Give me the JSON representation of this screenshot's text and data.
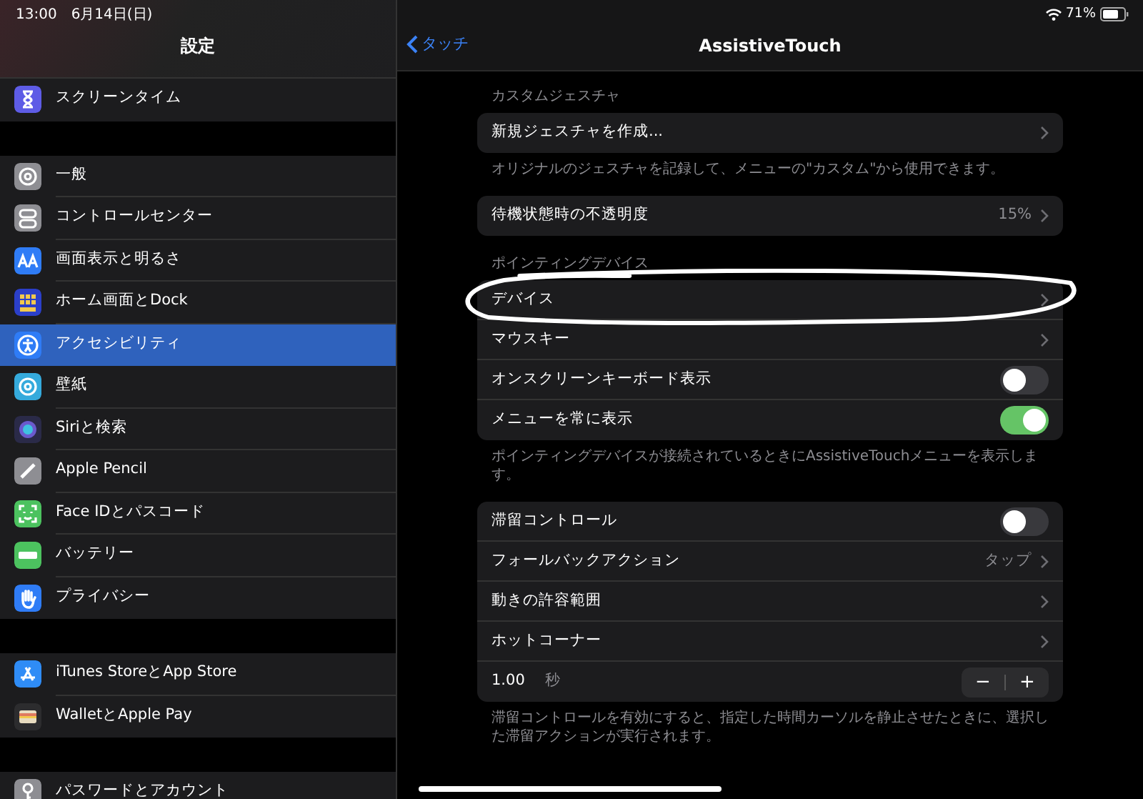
{
  "status_bar": {
    "time": "13:00",
    "date": "6月14日(日)",
    "battery": "71%"
  },
  "sidebar": {
    "title": "設定",
    "groups": [
      [
        {
          "label": "スクリーンタイム",
          "color": "#5e5ce6",
          "selected": false
        }
      ],
      [
        {
          "label": "一般",
          "color": "#8e8e93",
          "selected": false
        },
        {
          "label": "コントロールセンター",
          "color": "#8e8e93",
          "selected": false
        },
        {
          "label": "画面表示と明るさ",
          "color": "#2f7cf6",
          "selected": false
        },
        {
          "label": "ホーム画面とDock",
          "color": "#2b3fc9",
          "selected": false
        },
        {
          "label": "アクセシビリティ",
          "color": "#2f7cf6",
          "selected": true
        },
        {
          "label": "壁紙",
          "color": "#35aadc",
          "selected": false
        },
        {
          "label": "Siriと検索",
          "color": "#2a2a48",
          "selected": false
        },
        {
          "label": "Apple Pencil",
          "color": "#8e8e93",
          "selected": false
        },
        {
          "label": "Face IDとパスコード",
          "color": "#4cc25f",
          "selected": false
        },
        {
          "label": "バッテリー",
          "color": "#4cc25f",
          "selected": false
        },
        {
          "label": "プライバシー",
          "color": "#2f7cf6",
          "selected": false
        }
      ],
      [
        {
          "label": "iTunes StoreとApp Store",
          "color": "#2f8cf6",
          "selected": false
        },
        {
          "label": "WalletとApple Pay",
          "color": "#2c2c2e",
          "selected": false
        }
      ],
      [
        {
          "label": "パスワードとアカウント",
          "color": "#8e8e93",
          "selected": false
        }
      ]
    ]
  },
  "nav": {
    "back": "タッチ",
    "title": "AssistiveTouch"
  },
  "sections": [
    {
      "header": "カスタムジェスチャ",
      "rows": [
        {
          "kind": "link",
          "label": "新規ジェスチャを作成..."
        }
      ],
      "footer": "オリジナルのジェスチャを記録して、メニューの\"カスタム\"から使用できます。"
    },
    {
      "rows": [
        {
          "kind": "link",
          "label": "待機状態時の不透明度",
          "value": "15%"
        }
      ]
    },
    {
      "header": "ポインティングデバイス",
      "rows": [
        {
          "kind": "link",
          "label": "デバイス",
          "circled": true
        },
        {
          "kind": "link",
          "label": "マウスキー"
        },
        {
          "kind": "toggle",
          "label": "オンスクリーンキーボード表示",
          "on": false
        },
        {
          "kind": "toggle",
          "label": "メニューを常に表示",
          "on": true
        }
      ],
      "footer": "ポインティングデバイスが接続されているときにAssistiveTouchメニューを表示します。"
    },
    {
      "rows": [
        {
          "kind": "toggle",
          "label": "滞留コントロール",
          "on": false
        },
        {
          "kind": "link",
          "label": "フォールバックアクション",
          "value": "タップ"
        },
        {
          "kind": "link",
          "label": "動きの許容範囲"
        },
        {
          "kind": "link",
          "label": "ホットコーナー"
        },
        {
          "kind": "stepper",
          "value": "1.00",
          "unit": "秒",
          "minus": "−",
          "plus": "+"
        }
      ],
      "footer": "滞留コントロールを有効にすると、指定した時間カーソルを静止させたときに、選択した滞留アクションが実行されます。"
    }
  ]
}
